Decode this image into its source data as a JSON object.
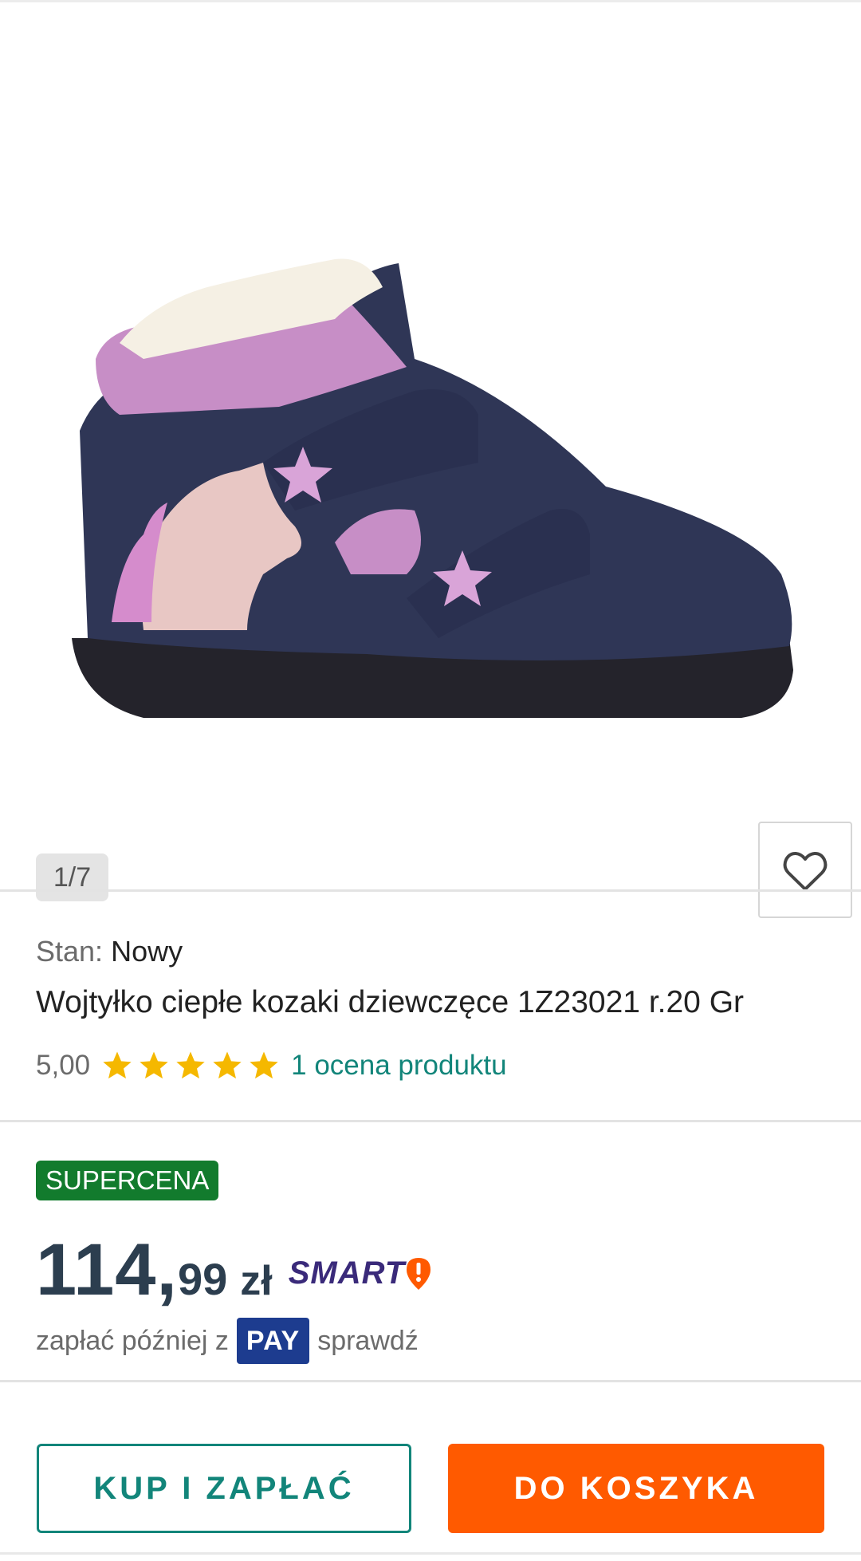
{
  "gallery": {
    "counter": "1/7",
    "favorite_icon": "heart-icon",
    "image_subject": "navy-girls-winter-boot-with-unicorn-and-stars"
  },
  "product": {
    "condition_label": "Stan:",
    "condition_value": "Nowy",
    "title": "Wojtyłko ciepłe kozaki dziewczęce 1Z23021 r.20 Gr",
    "rating_value": "5,00",
    "rating_stars": 5,
    "rating_link": "1 ocena produktu"
  },
  "price": {
    "badge": "SUPERCENA",
    "integer": "114,",
    "fraction": "99",
    "currency": "zł",
    "smart_logo": "SMART"
  },
  "payment": {
    "prefix": "zapłać później z",
    "pay_badge": "PAY",
    "check": "sprawdź"
  },
  "actions": {
    "buy_now": "KUP I ZAPŁAĆ",
    "add_to_cart": "DO KOSZYKA"
  },
  "colors": {
    "teal": "#12857a",
    "orange": "#ff5a00",
    "supercena_green": "#127b2d",
    "pay_blue": "#1d3c8f",
    "price": "#2c3e4f",
    "star": "#f5b800"
  }
}
